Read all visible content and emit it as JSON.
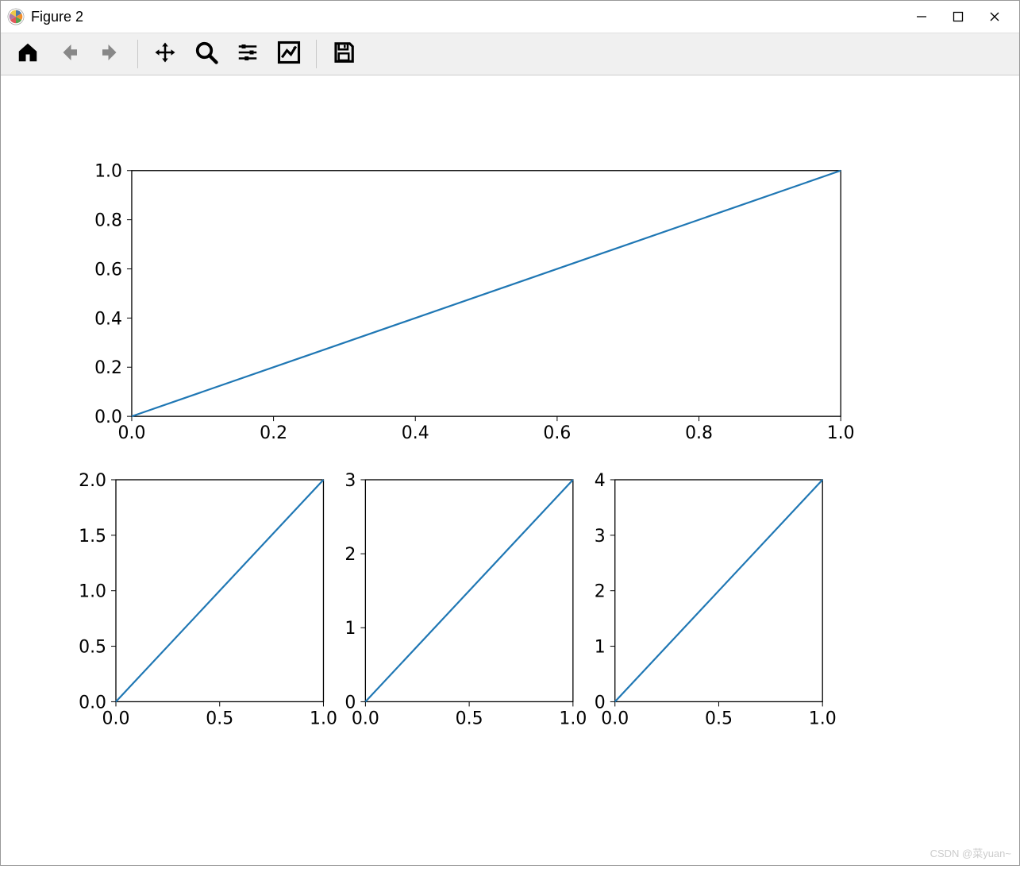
{
  "window": {
    "title": "Figure 2"
  },
  "toolbar": {
    "home": "home-icon",
    "back": "back-icon",
    "forward": "forward-icon",
    "pan": "pan-icon",
    "zoom": "zoom-icon",
    "configure": "configure-icon",
    "edit": "edit-icon",
    "save": "save-icon"
  },
  "watermark": "CSDN @菜yuan~",
  "line_color": "#1f77b4",
  "chart_data": [
    {
      "type": "line",
      "x": [
        0.0,
        1.0
      ],
      "y": [
        0.0,
        1.0
      ],
      "xlim": [
        0.0,
        1.0
      ],
      "ylim": [
        0.0,
        1.0
      ],
      "xticks": [
        0.0,
        0.2,
        0.4,
        0.6,
        0.8,
        1.0
      ],
      "yticks": [
        0.0,
        0.2,
        0.4,
        0.6,
        0.8,
        1.0
      ],
      "xtick_labels": [
        "0.0",
        "0.2",
        "0.4",
        "0.6",
        "0.8",
        "1.0"
      ],
      "ytick_labels": [
        "0.0",
        "0.2",
        "0.4",
        "0.6",
        "0.8",
        "1.0"
      ]
    },
    {
      "type": "line",
      "x": [
        0.0,
        1.0
      ],
      "y": [
        0.0,
        2.0
      ],
      "xlim": [
        0.0,
        1.0
      ],
      "ylim": [
        0.0,
        2.0
      ],
      "xticks": [
        0.0,
        0.5,
        1.0
      ],
      "yticks": [
        0.0,
        0.5,
        1.0,
        1.5,
        2.0
      ],
      "xtick_labels": [
        "0.0",
        "0.5",
        "1.0"
      ],
      "ytick_labels": [
        "0.0",
        "0.5",
        "1.0",
        "1.5",
        "2.0"
      ]
    },
    {
      "type": "line",
      "x": [
        0.0,
        1.0
      ],
      "y": [
        0.0,
        3.0
      ],
      "xlim": [
        0.0,
        1.0
      ],
      "ylim": [
        0.0,
        3.0
      ],
      "xticks": [
        0.0,
        0.5,
        1.0
      ],
      "yticks": [
        0,
        1,
        2,
        3
      ],
      "xtick_labels": [
        "0.0",
        "0.5",
        "1.0"
      ],
      "ytick_labels": [
        "0",
        "1",
        "2",
        "3"
      ]
    },
    {
      "type": "line",
      "x": [
        0.0,
        1.0
      ],
      "y": [
        0.0,
        4.0
      ],
      "xlim": [
        0.0,
        1.0
      ],
      "ylim": [
        0.0,
        4.0
      ],
      "xticks": [
        0.0,
        0.5,
        1.0
      ],
      "yticks": [
        0,
        1,
        2,
        3,
        4
      ],
      "xtick_labels": [
        "0.0",
        "0.5",
        "1.0"
      ],
      "ytick_labels": [
        "0",
        "1",
        "2",
        "3",
        "4"
      ]
    }
  ]
}
